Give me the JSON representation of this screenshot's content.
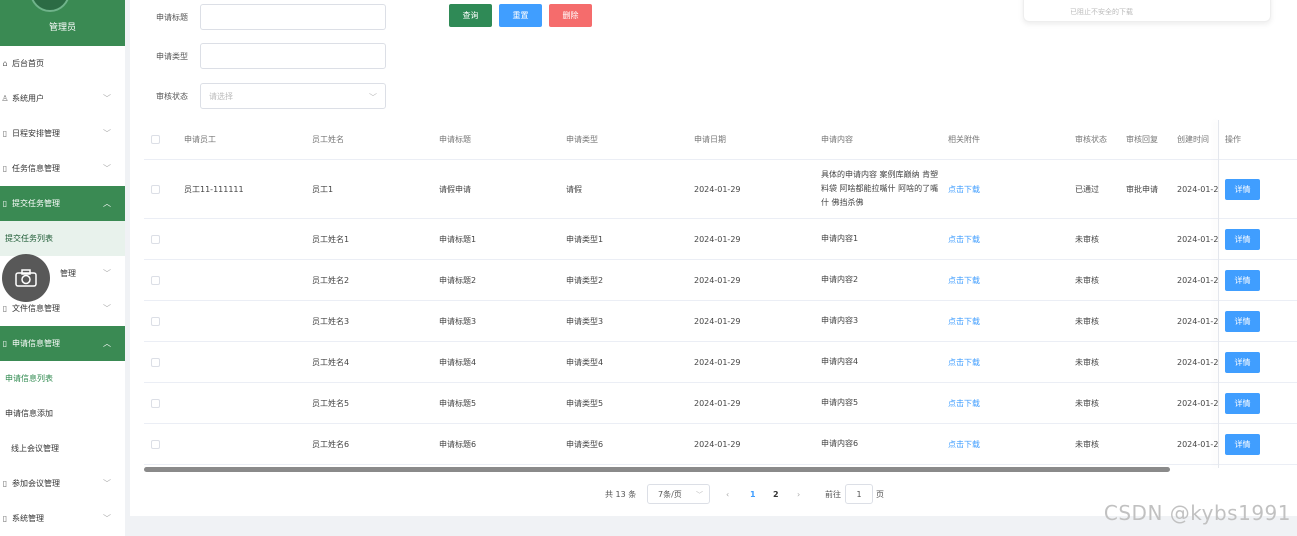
{
  "sidebar": {
    "role": "管理员",
    "items": [
      {
        "icon": "⌂",
        "label": "后台首页",
        "type": "item",
        "chevron": ""
      },
      {
        "icon": "♙",
        "label": "系统用户",
        "type": "item",
        "chevron": "﹀"
      },
      {
        "icon": "▯",
        "label": "日程安排管理",
        "type": "item",
        "chevron": "﹀"
      },
      {
        "icon": "▯",
        "label": "任务信息管理",
        "type": "item",
        "chevron": "﹀"
      },
      {
        "icon": "▯",
        "label": "提交任务管理",
        "type": "active",
        "chevron": "︿"
      },
      {
        "icon": "",
        "label": "提交任务列表",
        "type": "sub-highlight",
        "chevron": ""
      },
      {
        "icon": "",
        "label": "管理",
        "type": "item-covered",
        "chevron": "﹀"
      },
      {
        "icon": "▯",
        "label": "文件信息管理",
        "type": "item",
        "chevron": "﹀"
      },
      {
        "icon": "▯",
        "label": "申请信息管理",
        "type": "active",
        "chevron": "︿"
      },
      {
        "icon": "",
        "label": "申请信息列表",
        "type": "sub-selected",
        "chevron": ""
      },
      {
        "icon": "",
        "label": "申请信息添加",
        "type": "sub",
        "chevron": ""
      },
      {
        "icon": "",
        "label": "线上会议管理",
        "type": "sub-indent",
        "chevron": ""
      },
      {
        "icon": "▯",
        "label": "参加会议管理",
        "type": "item",
        "chevron": "﹀"
      },
      {
        "icon": "▯",
        "label": "系统管理",
        "type": "item",
        "chevron": "﹀"
      }
    ]
  },
  "search": {
    "title_label": "申请标题",
    "type_label": "申请类型",
    "status_label": "审核状态",
    "status_placeholder": "请选择",
    "query_btn": "查询",
    "reset_btn": "重置",
    "delete_btn": "删除"
  },
  "popup": {
    "text": "已阻止不安全的下载"
  },
  "table": {
    "columns": [
      "申请员工",
      "员工姓名",
      "申请标题",
      "申请类型",
      "申请日期",
      "申请内容",
      "相关附件",
      "审核状态",
      "审核回复",
      "创建时间",
      "操作"
    ],
    "rows": [
      {
        "employee": "员工11-111111",
        "name": "员工1",
        "title": "请假申请",
        "type": "请假",
        "date": "2024-01-29",
        "content": "具体的申请内容 案例库巅纳 肯塑料袋 阿啥都能拉嘴什 阿啥的了嘴什 佛挡杀佛",
        "attachment": "点击下载",
        "status": "已通过",
        "reply": "审批申请",
        "created": "2024-01-2",
        "action": "详情"
      },
      {
        "employee": "",
        "name": "员工姓名1",
        "title": "申请标题1",
        "type": "申请类型1",
        "date": "2024-01-29",
        "content": "申请内容1",
        "attachment": "点击下载",
        "status": "未审核",
        "reply": "",
        "created": "2024-01-2",
        "action": "详情"
      },
      {
        "employee": "",
        "name": "员工姓名2",
        "title": "申请标题2",
        "type": "申请类型2",
        "date": "2024-01-29",
        "content": "申请内容2",
        "attachment": "点击下载",
        "status": "未审核",
        "reply": "",
        "created": "2024-01-2",
        "action": "详情"
      },
      {
        "employee": "",
        "name": "员工姓名3",
        "title": "申请标题3",
        "type": "申请类型3",
        "date": "2024-01-29",
        "content": "申请内容3",
        "attachment": "点击下载",
        "status": "未审核",
        "reply": "",
        "created": "2024-01-2",
        "action": "详情"
      },
      {
        "employee": "",
        "name": "员工姓名4",
        "title": "申请标题4",
        "type": "申请类型4",
        "date": "2024-01-29",
        "content": "申请内容4",
        "attachment": "点击下载",
        "status": "未审核",
        "reply": "",
        "created": "2024-01-2",
        "action": "详情"
      },
      {
        "employee": "",
        "name": "员工姓名5",
        "title": "申请标题5",
        "type": "申请类型5",
        "date": "2024-01-29",
        "content": "申请内容5",
        "attachment": "点击下载",
        "status": "未审核",
        "reply": "",
        "created": "2024-01-2",
        "action": "详情"
      },
      {
        "employee": "",
        "name": "员工姓名6",
        "title": "申请标题6",
        "type": "申请类型6",
        "date": "2024-01-29",
        "content": "申请内容6",
        "attachment": "点击下载",
        "status": "未审核",
        "reply": "",
        "created": "2024-01-2",
        "action": "详情"
      }
    ]
  },
  "pagination": {
    "total": "共 13 条",
    "page_size": "7条/页",
    "prev": "‹",
    "pages": [
      "1",
      "2"
    ],
    "current": "1",
    "next": "›",
    "goto_label": "前往",
    "goto_value": "1",
    "goto_suffix": "页"
  },
  "watermark": "CSDN @kybs1991",
  "colors": {
    "brand_green": "#3a8a53",
    "primary_blue": "#409eff",
    "danger_red": "#f56c6c",
    "query_green": "#2f8a56"
  }
}
